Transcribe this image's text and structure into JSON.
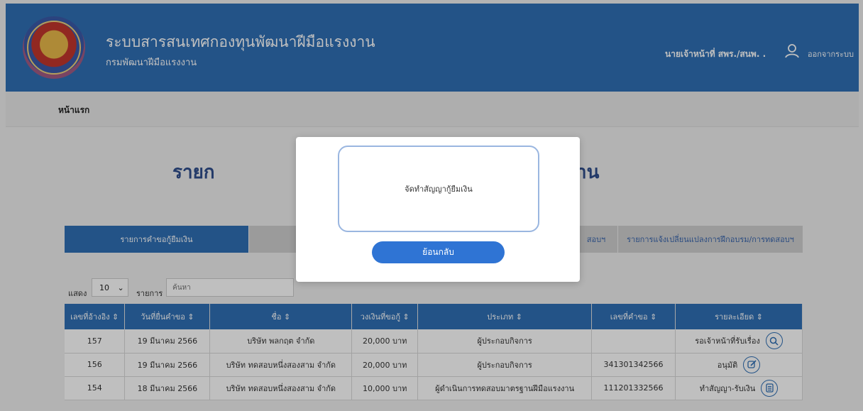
{
  "header": {
    "title": "ระบบสารสนเทศกองทุนพัฒนาฝีมือแรงงาน",
    "subtitle": "กรมพัฒนาฝีมือแรงงาน",
    "user_name": "นายเจ้าหน้าที่ สพร./สนพ. .",
    "logout_label": "ออกจากระบบ"
  },
  "breadcrumb": {
    "home": "หน้าแรก"
  },
  "page": {
    "title_left": "รายก",
    "title_right": "าน"
  },
  "tabs": {
    "loan_requests": "รายการคำขอกู้ยืมเงิน",
    "tab3_partial": "สอบฯ",
    "training_changes": "รายการแจ้งเปลี่ยนแปลงการฝึกอบรม/การทดสอบฯ"
  },
  "table_controls": {
    "show_label": "แสดง",
    "page_length": "10",
    "items_label": "รายการ",
    "search_placeholder": "ค้นหา"
  },
  "table": {
    "columns": [
      "เลขที่อ้างอิง ⇕",
      "วันที่ยื่นคำขอ ⇕",
      "ชื่อ ⇕",
      "วงเงินที่ขอกู้ ⇕",
      "ประเภท ⇕",
      "เลขที่คำขอ ⇕",
      "รายละเอียด ⇕"
    ],
    "rows": [
      {
        "ref": "157",
        "date": "19 มีนาคม 2566",
        "name": "บริษัท พลกฤต จำกัด",
        "amount": "20,000 บาท",
        "type": "ผู้ประกอบกิจการ",
        "req_no": "",
        "status": "รอเจ้าหน้าที่รับเรื่อง",
        "icon": "search-icon"
      },
      {
        "ref": "156",
        "date": "19 มีนาคม 2566",
        "name": "บริษัท ทดสอบหนึ่งสองสาม จำกัด",
        "amount": "20,000 บาท",
        "type": "ผู้ประกอบกิจการ",
        "req_no": "341301342566",
        "status": "อนุมัติ",
        "icon": "edit-icon"
      },
      {
        "ref": "154",
        "date": "18 มีนาคม 2566",
        "name": "บริษัท ทดสอบหนึ่งสองสาม จำกัด",
        "amount": "10,000 บาท",
        "type": "ผู้ดำเนินการทดสอบมาตรฐานฝีมือแรงงาน",
        "req_no": "111201332566",
        "status": "ทำสัญญา-รับเงิน",
        "icon": "document-icon"
      }
    ]
  },
  "modal": {
    "message": "จัดทำสัญญากู้ยืมเงิน",
    "back_button": "ย้อนกลับ"
  }
}
